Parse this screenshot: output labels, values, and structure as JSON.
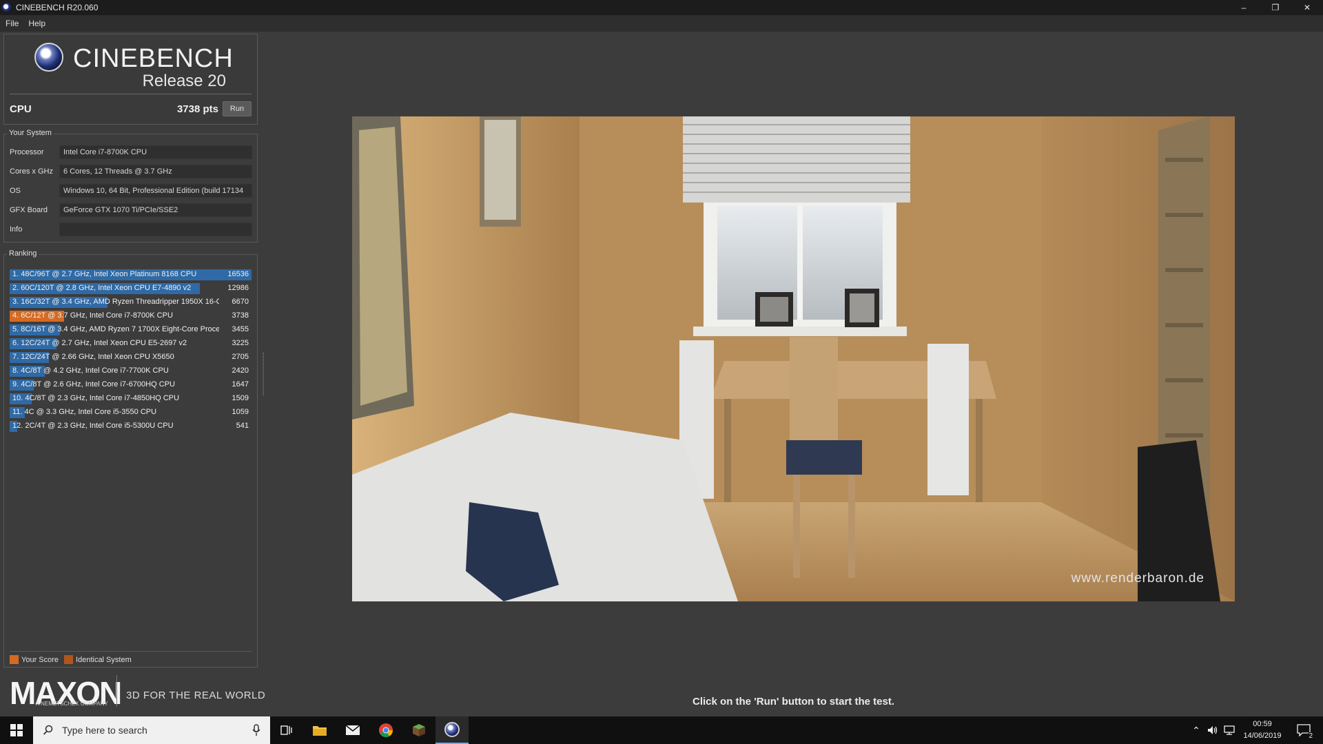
{
  "window": {
    "title": "CINEBENCH R20.060",
    "minimize": "–",
    "maximize": "❐",
    "close": "✕"
  },
  "menu": {
    "file": "File",
    "help": "Help"
  },
  "header": {
    "brand": "CINEBENCH",
    "release": "Release 20"
  },
  "cpu": {
    "label": "CPU",
    "score": "3738 pts",
    "run_label": "Run"
  },
  "system": {
    "group_label": "Your System",
    "rows": [
      {
        "key": "Processor",
        "value": "Intel Core i7-8700K CPU"
      },
      {
        "key": "Cores x GHz",
        "value": "6 Cores, 12 Threads @ 3.7 GHz"
      },
      {
        "key": "OS",
        "value": "Windows 10, 64 Bit, Professional Edition (build 17134"
      },
      {
        "key": "GFX Board",
        "value": "GeForce GTX 1070 Ti/PCIe/SSE2"
      },
      {
        "key": "Info",
        "value": ""
      }
    ]
  },
  "ranking": {
    "group_label": "Ranking",
    "max_score": 16536,
    "rows": [
      {
        "label": "1. 48C/96T @ 2.7 GHz, Intel Xeon Platinum 8168 CPU",
        "score": 16536,
        "score_text": "16536",
        "mine": false
      },
      {
        "label": "2. 60C/120T @ 2.8 GHz, Intel Xeon CPU E7-4890 v2",
        "score": 12986,
        "score_text": "12986",
        "mine": false
      },
      {
        "label": "3. 16C/32T @ 3.4 GHz, AMD Ryzen Threadripper 1950X 16-C",
        "score": 6670,
        "score_text": "6670",
        "mine": false
      },
      {
        "label": "4. 6C/12T @ 3.7 GHz, Intel Core i7-8700K CPU",
        "score": 3738,
        "score_text": "3738",
        "mine": true
      },
      {
        "label": "5. 8C/16T @ 3.4 GHz, AMD Ryzen 7 1700X Eight-Core Proces",
        "score": 3455,
        "score_text": "3455",
        "mine": false
      },
      {
        "label": "6. 12C/24T @ 2.7 GHz, Intel Xeon CPU E5-2697 v2",
        "score": 3225,
        "score_text": "3225",
        "mine": false
      },
      {
        "label": "7. 12C/24T @ 2.66 GHz, Intel Xeon CPU X5650",
        "score": 2705,
        "score_text": "2705",
        "mine": false
      },
      {
        "label": "8. 4C/8T @ 4.2 GHz, Intel Core i7-7700K CPU",
        "score": 2420,
        "score_text": "2420",
        "mine": false
      },
      {
        "label": "9. 4C/8T @ 2.6 GHz, Intel Core i7-6700HQ CPU",
        "score": 1647,
        "score_text": "1647",
        "mine": false
      },
      {
        "label": "10. 4C/8T @ 2.3 GHz, Intel Core i7-4850HQ CPU",
        "score": 1509,
        "score_text": "1509",
        "mine": false
      },
      {
        "label": "11. 4C @ 3.3 GHz, Intel Core i5-3550 CPU",
        "score": 1059,
        "score_text": "1059",
        "mine": false
      },
      {
        "label": "12. 2C/4T @ 2.3 GHz, Intel Core i5-5300U CPU",
        "score": 541,
        "score_text": "541",
        "mine": false
      }
    ],
    "legend": {
      "your_score": "Your Score",
      "identical": "Identical System"
    }
  },
  "colors": {
    "bar": "#2f6aa6",
    "mine": "#d66a22",
    "identical": "#b0561c"
  },
  "footer": {
    "brand": "MAXON",
    "sub": "A NEMETSCHEK COMPANY",
    "tagline": "3D FOR THE REAL WORLD"
  },
  "render": {
    "watermark": "www.renderbaron.de"
  },
  "status": {
    "message": "Click on the 'Run' button to start the test."
  },
  "taskbar": {
    "search_placeholder": "Type here to search",
    "time": "00:59",
    "date": "14/06/2019",
    "notification_count": "2",
    "icons": [
      "windows-start-icon",
      "microphone-icon",
      "task-view-icon",
      "file-explorer-icon",
      "mail-icon",
      "chrome-icon",
      "minecraft-icon",
      "cinebench-icon"
    ]
  }
}
